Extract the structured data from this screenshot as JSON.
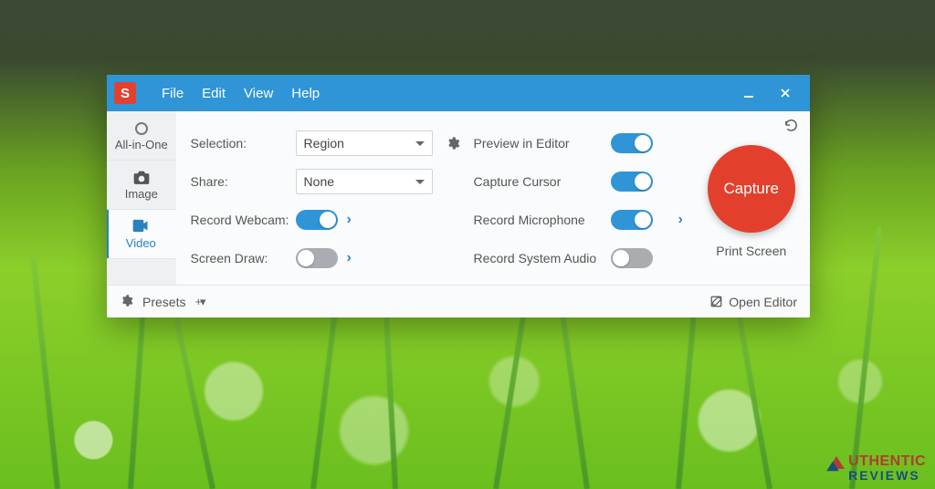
{
  "app": {
    "logo_letter": "S"
  },
  "menubar": {
    "file": "File",
    "edit": "Edit",
    "view": "View",
    "help": "Help"
  },
  "tabs": {
    "all_in_one": "All-in-One",
    "image": "Image",
    "video": "Video"
  },
  "labels": {
    "selection": "Selection:",
    "share": "Share:",
    "record_webcam": "Record Webcam:",
    "screen_draw": "Screen Draw:",
    "preview_editor": "Preview in Editor",
    "capture_cursor": "Capture Cursor",
    "record_microphone": "Record Microphone",
    "record_system_audio": "Record System Audio"
  },
  "values": {
    "selection": "Region",
    "share": "None"
  },
  "toggles": {
    "record_webcam": true,
    "screen_draw": false,
    "preview_editor": true,
    "capture_cursor": true,
    "record_microphone": true,
    "record_system_audio": false
  },
  "capture": {
    "button": "Capture",
    "shortcut": "Print Screen"
  },
  "footer": {
    "presets": "Presets",
    "open_editor": "Open Editor"
  },
  "watermark": {
    "line1": "UTHENTIC",
    "line2": "REVIEWS"
  }
}
